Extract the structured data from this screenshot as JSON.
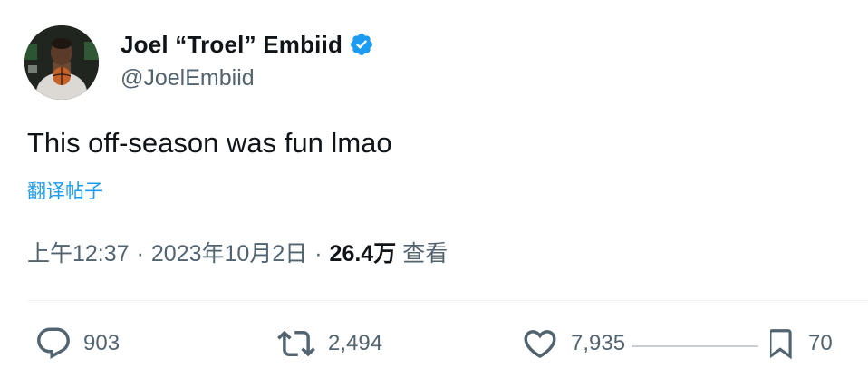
{
  "author": {
    "display_name": "Joel “Troel” Embiid",
    "handle": "@JoelEmbiid",
    "avatar_icon": "user-avatar",
    "verified_icon": "verified-badge-icon",
    "verified_color": "#1d9bf0"
  },
  "tweet": {
    "text": "This off-season was fun lmao",
    "translate_label": "翻译帖子"
  },
  "meta": {
    "time": "上午12:37",
    "separator": "·",
    "date": "2023年10月2日",
    "views_count": "26.4万",
    "views_label": "查看"
  },
  "actions": {
    "reply": {
      "icon": "reply-icon",
      "count": "903"
    },
    "retweet": {
      "icon": "retweet-icon",
      "count": "2,494"
    },
    "like": {
      "icon": "like-icon",
      "count": "7,935"
    },
    "bookmark": {
      "icon": "bookmark-icon",
      "count": "70"
    }
  },
  "colors": {
    "text_primary": "#0f1419",
    "text_secondary": "#536471",
    "link": "#1d9bf0",
    "divider": "#eff3f4"
  }
}
